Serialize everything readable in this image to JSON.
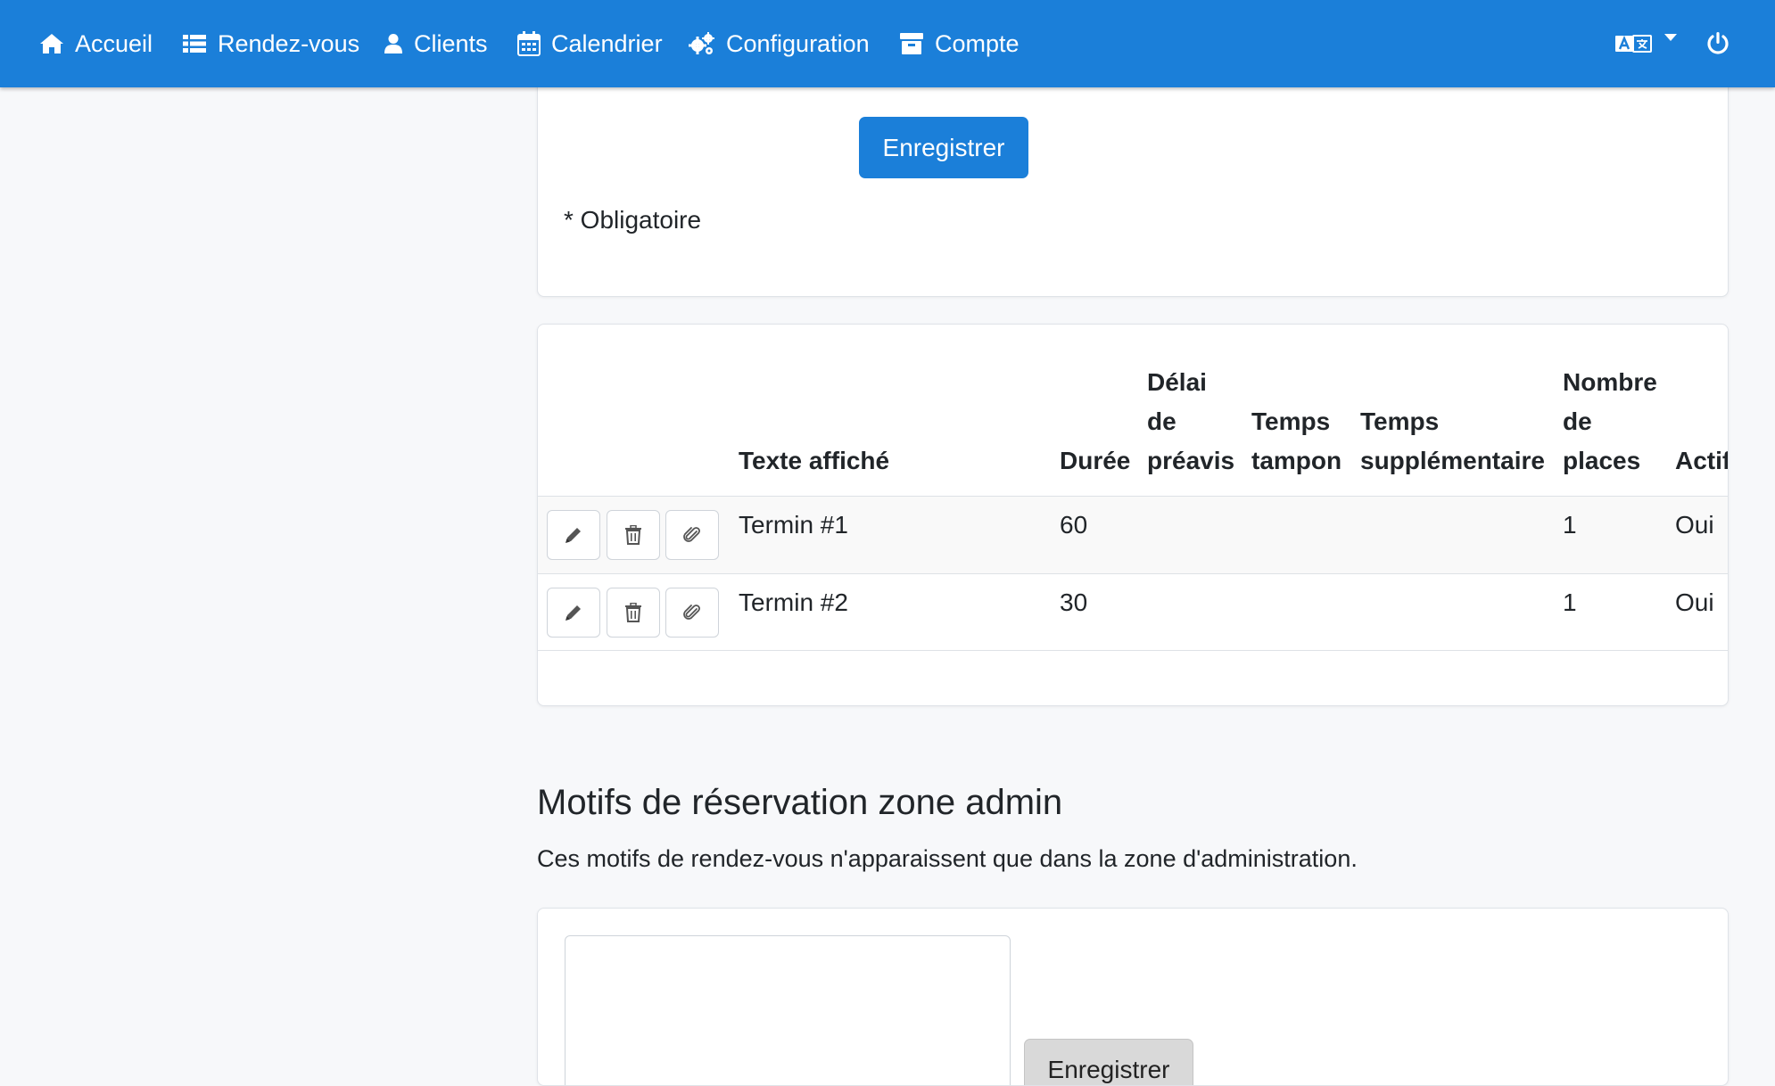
{
  "navbar": {
    "items": [
      {
        "label": "Accueil",
        "icon": "home-icon"
      },
      {
        "label": "Rendez-vous",
        "icon": "list-icon"
      },
      {
        "label": "Clients",
        "icon": "user-icon"
      },
      {
        "label": "Calendrier",
        "icon": "calendar-icon"
      },
      {
        "label": "Configuration",
        "icon": "cogs-icon"
      },
      {
        "label": "Compte",
        "icon": "archive-icon"
      }
    ],
    "language_icon": "language-icon",
    "logout_icon": "power-icon",
    "color": "#1b7fd9"
  },
  "top_card": {
    "save_label": "Enregistrer",
    "required_note": "* Obligatoire"
  },
  "table": {
    "headers": {
      "text": "Texte affiché",
      "duration": "Durée",
      "notice_1": "Délai",
      "notice_2": "de",
      "notice_3": "préavis",
      "buffer_1": "Temps",
      "buffer_2": "tampon",
      "extra_1": "Temps",
      "extra_2": "supplémentaire",
      "places_1": "Nombre",
      "places_2": "de",
      "places_3": "places",
      "active": "Actif"
    },
    "rows": [
      {
        "text": "Termin #1",
        "duration": "60",
        "notice": "",
        "buffer": "",
        "extra": "",
        "places": "1",
        "active": "Oui"
      },
      {
        "text": "Termin #2",
        "duration": "30",
        "notice": "",
        "buffer": "",
        "extra": "",
        "places": "1",
        "active": "Oui"
      }
    ]
  },
  "admin_section": {
    "title": "Motifs de réservation zone admin",
    "description": "Ces motifs de rendez-vous n'apparaissent que dans la zone d'administration.",
    "save_label": "Enregistrer"
  }
}
